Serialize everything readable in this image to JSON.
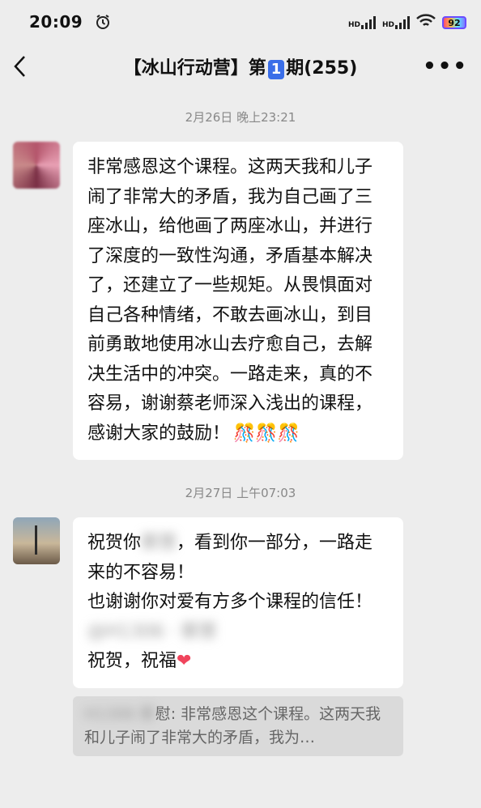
{
  "status_bar": {
    "time": "20:09",
    "hd1": "HD",
    "hd2": "HD",
    "battery": "92"
  },
  "nav": {
    "title_prefix": "【冰山行动营】第",
    "title_num": "1",
    "title_suffix": "期(255)",
    "more": "•••"
  },
  "messages": [
    {
      "timestamp": "2月26日 晚上23:21",
      "text": "非常感恩这个课程。这两天我和儿子闹了非常大的矛盾，我为自己画了三座冰山，给他画了两座冰山，并进行了深度的一致性沟通，矛盾基本解决了，还建立了一些规矩。从畏惧面对自己各种情绪，不敢去画冰山，到目前勇敢地使用冰山去疗愈自己，去解决生活中的冲突。一路走来，真的不容易，谢谢蔡老师深入浅出的课程，感谢大家的鼓励！",
      "emoji": "🎊🎊🎊"
    },
    {
      "timestamp": "2月27日 上午07:03",
      "line1_a": "祝贺你",
      "line1_blur": "蔡慧",
      "line1_b": "，看到你一部分，一路走来的不容易！",
      "line2": "也谢谢你对爱有方多个课程的信任！",
      "line2_blur": "@H1306 · 蔡慧",
      "line3": "祝贺，祝福",
      "heart": "❤",
      "quote_blur": "H1306 蔡",
      "quote_text": "慰: 非常感恩这个课程。这两天我和儿子闹了非常大的矛盾，我为…"
    }
  ]
}
